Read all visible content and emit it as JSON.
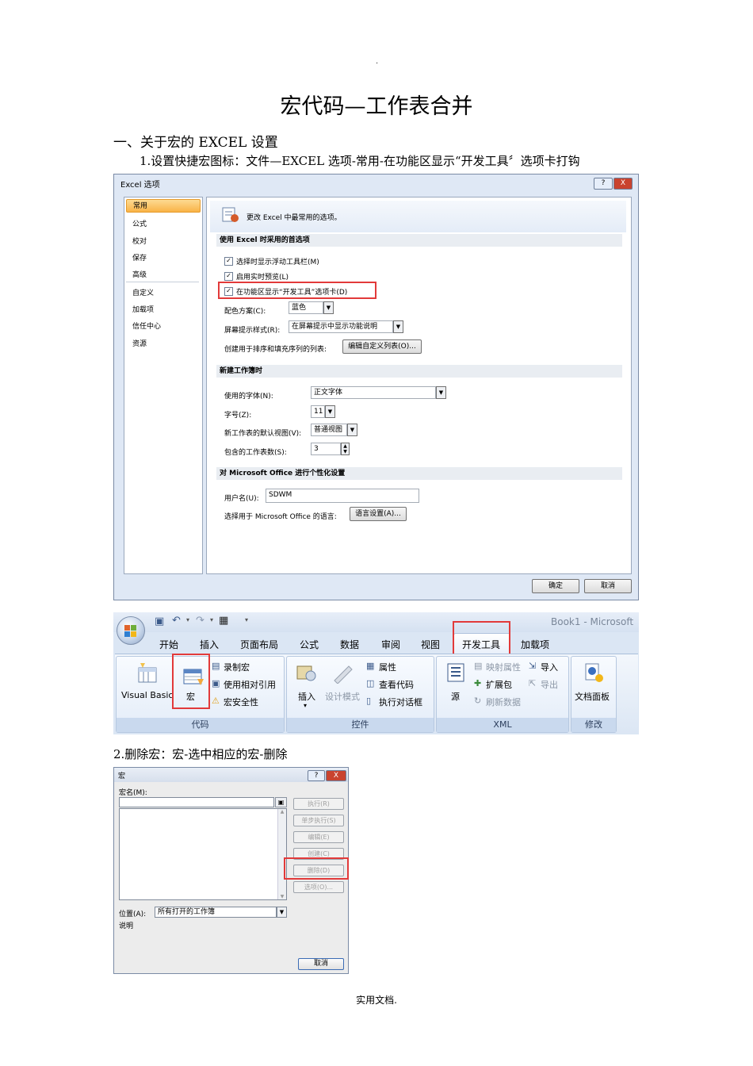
{
  "header_mark": ".",
  "title": "宏代码—工作表合并",
  "section1_heading": "一、关于宏的 EXCEL 设置",
  "step1": "1.设置快捷宏图标：文件—EXCEL 选项-常用-在功能区显示“开发工具〞选项卡打钩",
  "step2": "2.删除宏：宏-选中相应的宏-删除",
  "footer": "实用文档.",
  "excel_options": {
    "window_title": "Excel 选项",
    "help_btn": "?",
    "close_btn": "X",
    "nav": [
      "常用",
      "公式",
      "校对",
      "保存",
      "高级",
      "自定义",
      "加载项",
      "信任中心",
      "资源"
    ],
    "banner_text": "更改 Excel 中最常用的选项。",
    "section_top": "使用 Excel 时采用的首选项",
    "options": [
      {
        "label": "选择时显示浮动工具栏(M)",
        "checked": true
      },
      {
        "label": "启用实时预览(L)",
        "checked": true
      },
      {
        "label": "在功能区显示“开发工具”选项卡(D)",
        "checked": true
      }
    ],
    "color_scheme_label": "配色方案(C):",
    "color_scheme_value": "蓝色",
    "screentip_label": "屏幕提示样式(R):",
    "screentip_value": "在屏幕提示中显示功能说明",
    "custom_lists_label": "创建用于排序和填充序列的列表:",
    "custom_lists_btn": "编辑自定义列表(O)...",
    "section_new": "新建工作簿时",
    "font_label": "使用的字体(N):",
    "font_value": "正文字体",
    "size_label": "字号(Z):",
    "size_value": "11",
    "view_label": "新工作表的默认视图(V):",
    "view_value": "普通视图",
    "sheets_label": "包含的工作表数(S):",
    "sheets_value": "3",
    "section_personal": "对 Microsoft Office 进行个性化设置",
    "username_label": "用户名(U):",
    "username_value": "SDWM",
    "language_label": "选择用于 Microsoft Office 的语言:",
    "language_btn": "语言设置(A)...",
    "ok_btn": "确定",
    "cancel_btn": "取消"
  },
  "ribbon": {
    "window_title": "Book1 - Microsoft",
    "tabs": [
      "开始",
      "插入",
      "页面布局",
      "公式",
      "数据",
      "审阅",
      "视图",
      "开发工具",
      "加载项"
    ],
    "groups": {
      "code": {
        "label": "代码",
        "visual_basic": "Visual Basic",
        "macros": "宏",
        "record": "录制宏",
        "relative": "使用相对引用",
        "security": "宏安全性"
      },
      "controls": {
        "label": "控件",
        "insert": "插入",
        "design_mode": "设计模式",
        "properties": "属性",
        "view_code": "查看代码",
        "run_dialog": "执行对话框"
      },
      "xml": {
        "label": "XML",
        "source": "源",
        "map_props": "映射属性",
        "expansion": "扩展包",
        "refresh": "刷新数据",
        "import": "导入",
        "export": "导出"
      },
      "modify": {
        "label": "修改",
        "doc_panel": "文档面板"
      }
    }
  },
  "macro_dialog": {
    "title": "宏",
    "help_btn": "?",
    "close_btn": "X",
    "name_label": "宏名(M):",
    "buttons": [
      "执行(R)",
      "单步执行(S)",
      "编辑(E)",
      "创建(C)",
      "删除(D)",
      "选项(O)..."
    ],
    "location_label": "位置(A):",
    "location_value": "所有打开的工作簿",
    "description_label": "说明",
    "cancel_btn": "取消"
  }
}
